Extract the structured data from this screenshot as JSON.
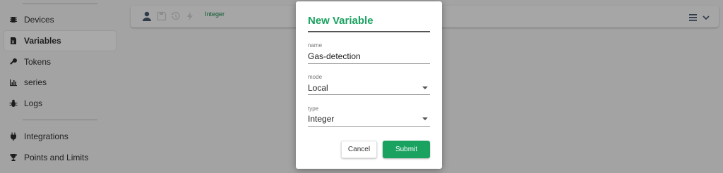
{
  "sidebar": {
    "items": [
      {
        "label": "Devices",
        "icon": "chip-icon"
      },
      {
        "label": "Variables",
        "icon": "variable-icon",
        "active": true
      },
      {
        "label": "Tokens",
        "icon": "key-icon"
      },
      {
        "label": "series",
        "icon": "chart-icon"
      },
      {
        "label": "Logs",
        "icon": "bug-icon"
      },
      {
        "label": "Integrations",
        "icon": "plug-icon"
      },
      {
        "label": "Points and Limits",
        "icon": "trophy-icon"
      }
    ]
  },
  "card": {
    "type_label": "Integer",
    "icons": [
      "user-icon",
      "save-icon",
      "history-icon",
      "bolt-icon",
      "menu-icon",
      "chevron-down-icon"
    ]
  },
  "modal": {
    "title": "New Variable",
    "fields": {
      "name": {
        "label": "name",
        "value": "Gas-detection"
      },
      "mode": {
        "label": "mode",
        "value": "Local"
      },
      "type": {
        "label": "type",
        "value": "Integer"
      }
    },
    "cancel_label": "Cancel",
    "submit_label": "Submit"
  },
  "colors": {
    "accent": "#1aa260",
    "overlay": "#a3a3a3"
  }
}
